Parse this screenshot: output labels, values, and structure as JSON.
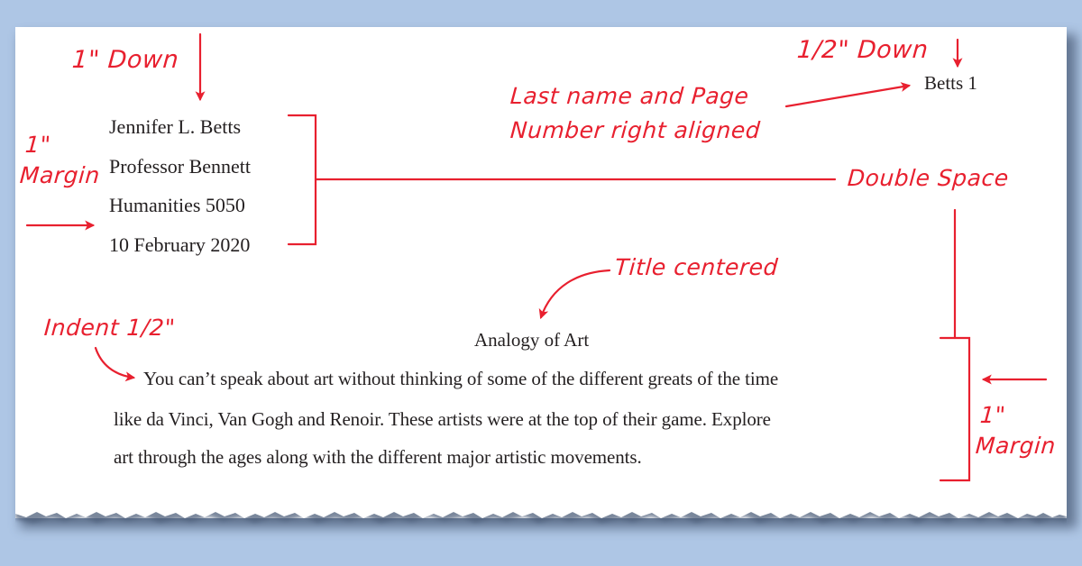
{
  "background_color": "#aec6e5",
  "annotation_color": "#e8202f",
  "document": {
    "running_head": "Betts 1",
    "heading_lines": [
      "Jennifer L. Betts",
      "Professor Bennett",
      "Humanities 5050",
      "10 February 2020"
    ],
    "title": "Analogy of Art",
    "body_lines": [
      "You can’t speak about art without thinking of some of the different greats of the time",
      "like da Vinci, Van Gogh and Renoir. These artists were at the top of their game. Explore",
      "art through the ages along with the different major artistic movements."
    ]
  },
  "annotations": {
    "one_inch_down": "1\" Down",
    "half_inch_down": "1/2\" Down",
    "last_name_line1": "Last name and Page",
    "last_name_line2": "Number right aligned",
    "left_margin_line1": "1\"",
    "left_margin_line2": "Margin",
    "double_space": "Double Space",
    "title_centered": "Title centered",
    "indent": "Indent 1/2\"",
    "right_margin_line1": "1\"",
    "right_margin_line2": "Margin"
  },
  "icons": {
    "arrow_down": "arrow-down-icon",
    "arrow_right": "arrow-right-icon",
    "arrow_left": "arrow-left-icon",
    "curved_arrow": "curved-arrow-icon",
    "bracket": "bracket-icon"
  }
}
